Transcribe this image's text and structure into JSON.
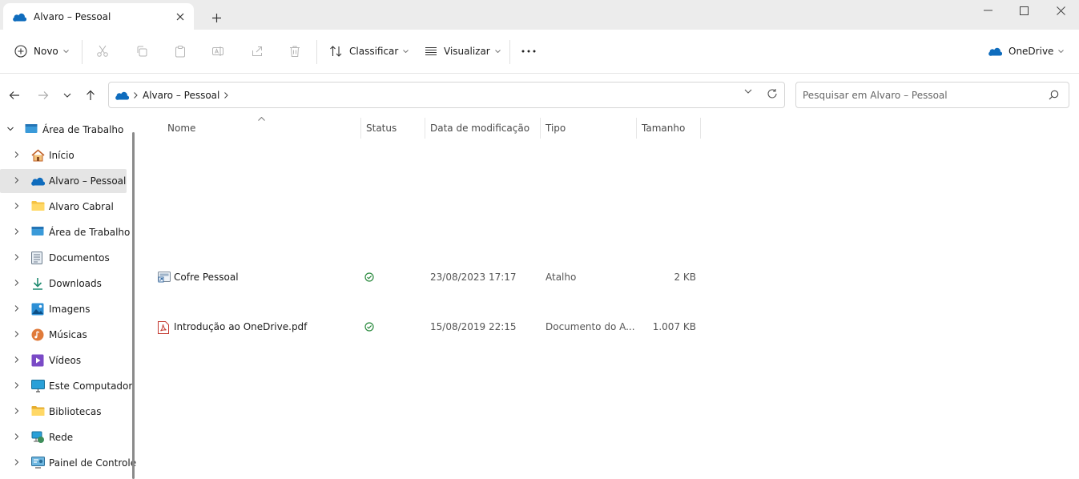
{
  "tab": {
    "title": "Alvaro – Pessoal",
    "icon": "onedrive-cloud-icon"
  },
  "toolbar": {
    "new_label": "Novo",
    "sort_label": "Classificar",
    "view_label": "Visualizar",
    "more_label": "...",
    "onedrive_label": "OneDrive",
    "icons": [
      "cut-icon",
      "copy-icon",
      "paste-icon",
      "rename-icon",
      "share-icon",
      "delete-icon"
    ]
  },
  "address": {
    "path": [
      "Alvaro – Pessoal"
    ]
  },
  "search": {
    "placeholder": "Pesquisar em Alvaro – Pessoal"
  },
  "sidebar": {
    "items": [
      {
        "label": "Área de Trabalho",
        "icon": "desktop-icon",
        "expanded": true
      },
      {
        "label": "Início",
        "icon": "home-icon"
      },
      {
        "label": "Alvaro – Pessoal",
        "icon": "onedrive-cloud-icon",
        "selected": true
      },
      {
        "label": "Alvaro Cabral",
        "icon": "folder-icon"
      },
      {
        "label": "Área de Trabalho",
        "icon": "desktop-icon"
      },
      {
        "label": "Documentos",
        "icon": "documents-icon"
      },
      {
        "label": "Downloads",
        "icon": "download-icon"
      },
      {
        "label": "Imagens",
        "icon": "pictures-icon"
      },
      {
        "label": "Músicas",
        "icon": "music-icon"
      },
      {
        "label": "Vídeos",
        "icon": "videos-icon"
      },
      {
        "label": "Este Computador",
        "icon": "computer-icon"
      },
      {
        "label": "Bibliotecas",
        "icon": "libraries-icon"
      },
      {
        "label": "Rede",
        "icon": "network-icon"
      },
      {
        "label": "Painel de Controle",
        "icon": "control-panel-icon"
      }
    ]
  },
  "columns": {
    "name": "Nome",
    "status": "Status",
    "modified": "Data de modificação",
    "type": "Tipo",
    "size": "Tamanho"
  },
  "files": [
    {
      "name": "Cofre Pessoal",
      "status": "synced",
      "modified": "23/08/2023 17:17",
      "type": "Atalho",
      "size": "2 KB",
      "icon": "shortcut-icon"
    },
    {
      "name": "Introdução ao OneDrive.pdf",
      "status": "synced",
      "modified": "15/08/2019 22:15",
      "type": "Documento do A...",
      "size": "1.007 KB",
      "icon": "pdf-icon"
    }
  ],
  "colors": {
    "onedrive_blue": "#0f6cbd",
    "synced_green": "#2a8a3e",
    "selection_grey": "#e5e5e5"
  }
}
